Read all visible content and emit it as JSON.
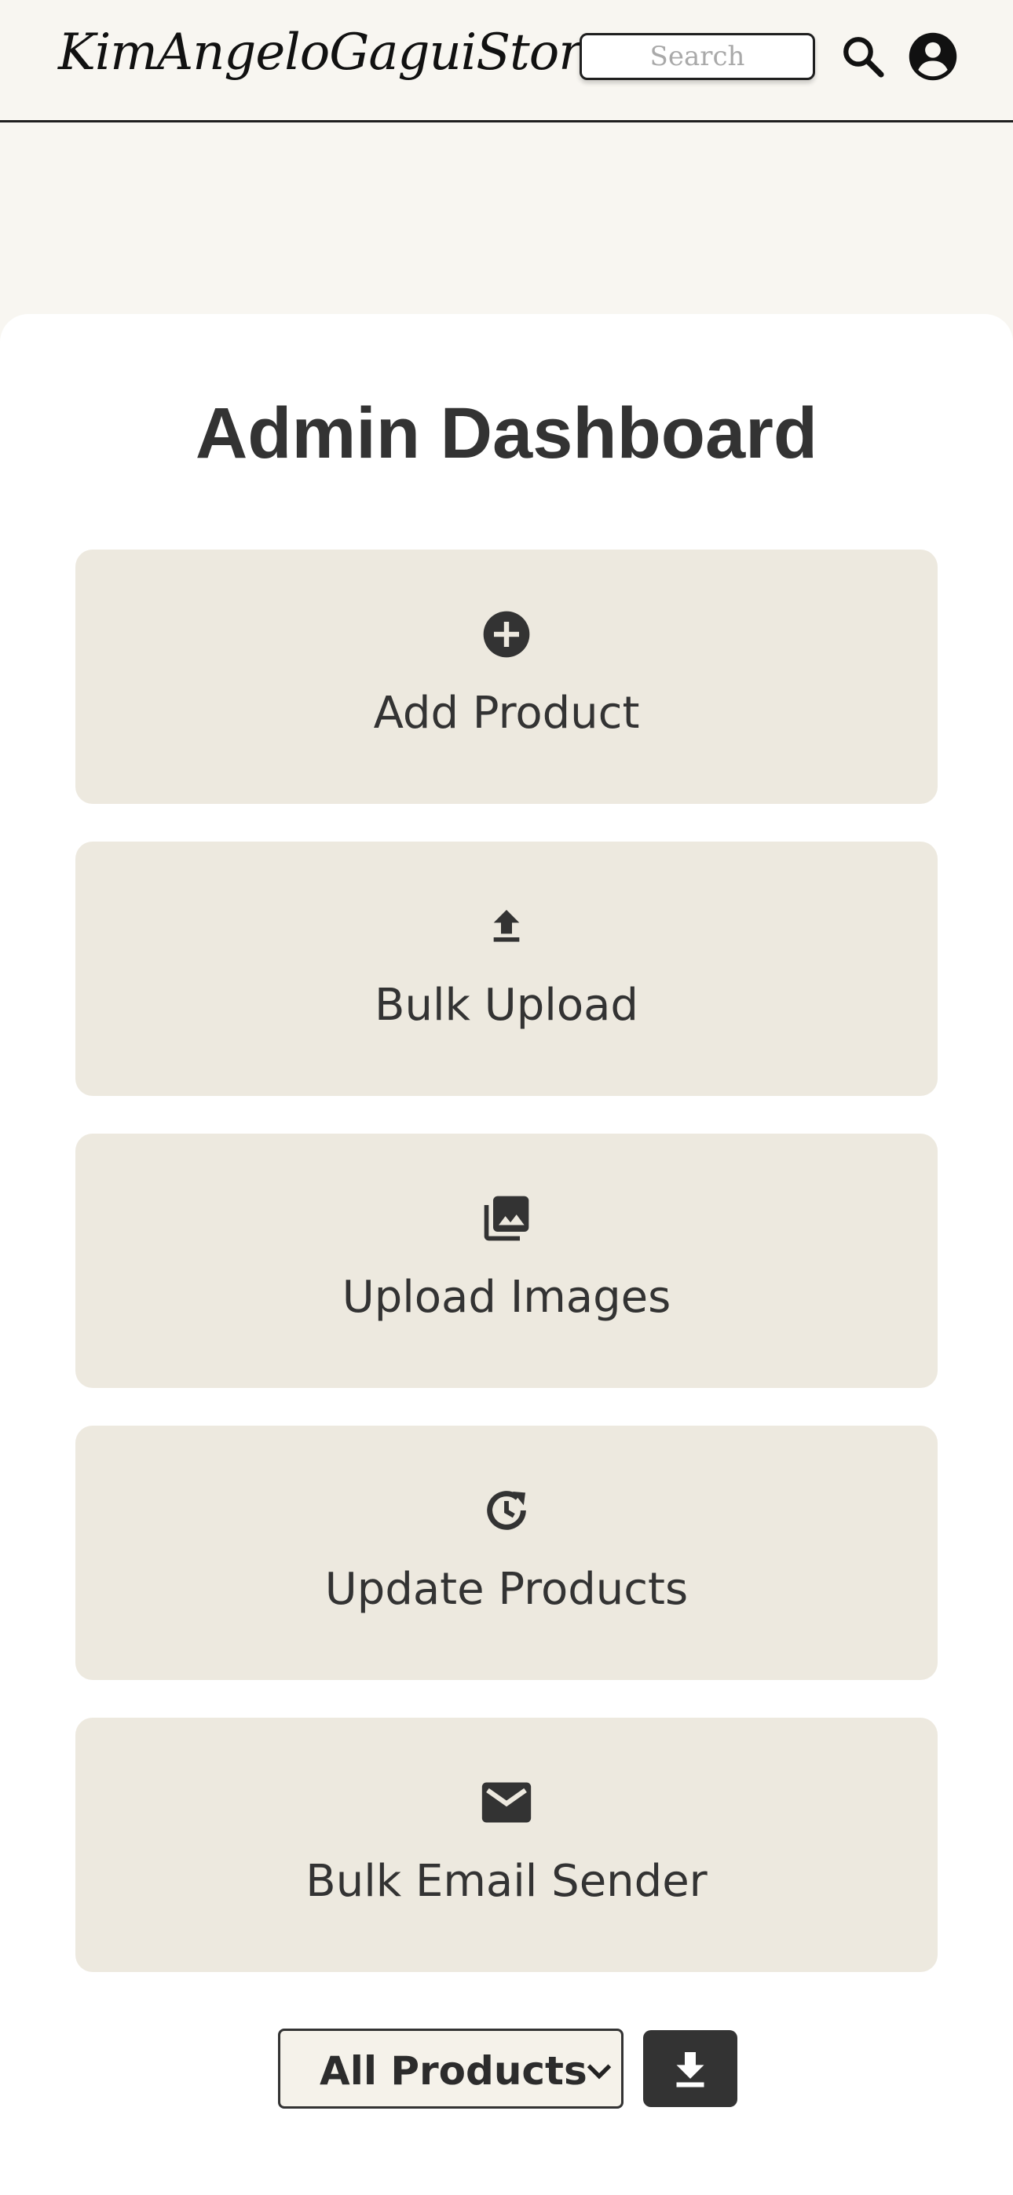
{
  "header": {
    "logo_text": "KimAngeloGaguiStore",
    "search_placeholder": "Search",
    "search_icon": "search-icon",
    "profile_icon": "account-circle-icon"
  },
  "main": {
    "title": "Admin Dashboard",
    "tiles": [
      {
        "label": "Add Product",
        "icon": "add-circle-icon"
      },
      {
        "label": "Bulk Upload",
        "icon": "upload-icon"
      },
      {
        "label": "Upload Images",
        "icon": "photo-library-icon"
      },
      {
        "label": "Update Products",
        "icon": "update-icon"
      },
      {
        "label": "Bulk Email Sender",
        "icon": "mail-icon"
      }
    ]
  },
  "export": {
    "select_value": "All Products",
    "download_icon": "download-icon"
  },
  "colors": {
    "background": "#f8f6f1",
    "panel": "#ffffff",
    "tile": "#ede9df",
    "text": "#333333",
    "button_dark": "#333333"
  }
}
